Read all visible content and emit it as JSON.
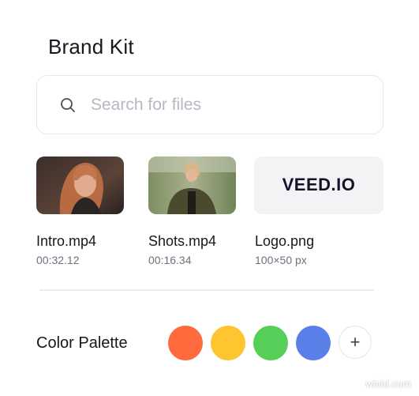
{
  "app": {
    "title": "Brand Kit"
  },
  "search": {
    "placeholder": "Search for files",
    "icon": "search-icon"
  },
  "files": [
    {
      "name": "Intro.mp4",
      "meta": "00:32.12",
      "kind": "video"
    },
    {
      "name": "Shots.mp4",
      "meta": "00:16.34",
      "kind": "video"
    },
    {
      "name": "Logo.png",
      "meta": "100×50 px",
      "kind": "image",
      "logo_text": "VEED.IO"
    }
  ],
  "palette": {
    "label": "Color Palette",
    "colors": [
      "#ff6a3d",
      "#ffc531",
      "#55cf57",
      "#5b7fe9"
    ],
    "add_label": "+"
  },
  "watermark": "wtvid.com"
}
